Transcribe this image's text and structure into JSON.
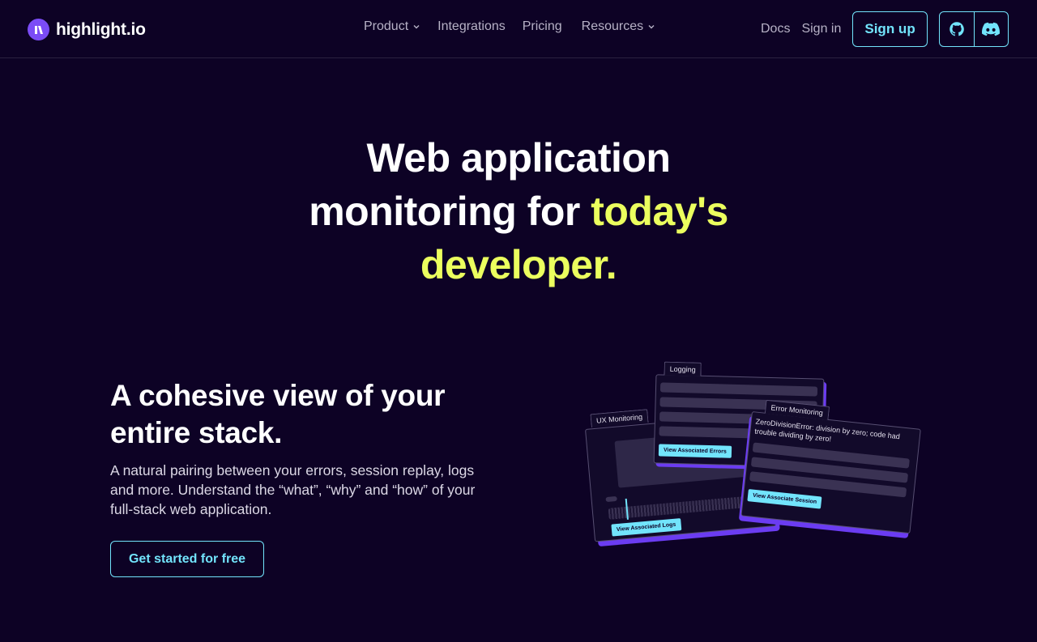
{
  "nav": {
    "logo_text": "highlight.io",
    "links": [
      {
        "label": "Product",
        "dropdown": true
      },
      {
        "label": "Integrations",
        "dropdown": false
      },
      {
        "label": "Pricing",
        "dropdown": false
      },
      {
        "label": "Resources",
        "dropdown": true
      }
    ],
    "docs": "Docs",
    "sign_in": "Sign in",
    "sign_up": "Sign up",
    "social_icons": [
      "github-icon",
      "discord-icon"
    ]
  },
  "hero": {
    "line1": "Web application",
    "line2_plain": "monitoring for ",
    "line2_highlight": "today's",
    "line3_highlight": "developer."
  },
  "section": {
    "title": "A cohesive view of your entire stack.",
    "body": "A natural pairing between your errors, session replay, logs and more. Understand the “what”, “why” and “how” of your full-stack web application.",
    "cta": "Get started for free"
  },
  "illustration": {
    "logging_tab": "Logging",
    "logging_button": "View Associated Errors",
    "ux_tab": "UX Monitoring",
    "ux_button": "View Associated Logs",
    "error_tab": "Error Monitoring",
    "error_text": "ZeroDivisionError: division by zero; code had trouble dividing by zero!",
    "error_button": "View Associate Session"
  },
  "colors": {
    "background": "#0d0225",
    "accent_cyan": "#72e4fc",
    "accent_yellow": "#ebff5e",
    "brand_purple": "#7b4cf6"
  }
}
